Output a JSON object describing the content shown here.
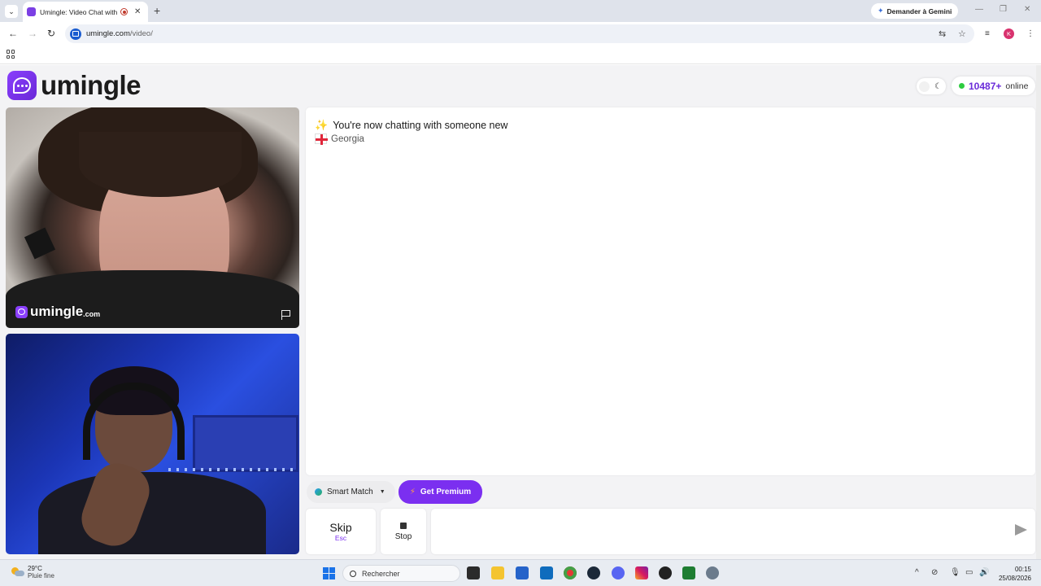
{
  "browser": {
    "tab_title": "Umingle: Video Chat with S",
    "tab_close": "✕",
    "new_tab": "+",
    "gemini_label": "Demander à Gemini",
    "url_host": "umingle.com",
    "url_path": "/video/",
    "profile_initial": "K"
  },
  "header": {
    "logo_text": "umingle",
    "online_count": "10487+",
    "online_label": "online"
  },
  "video": {
    "watermark_text": "umingle",
    "watermark_domain": ".com"
  },
  "chat": {
    "message": "You're now chatting with someone new",
    "country": "Georgia",
    "input_placeholder": ""
  },
  "controls": {
    "smart_match_label": "Smart Match",
    "premium_label": "Get Premium",
    "skip_label": "Skip",
    "skip_key": "Esc",
    "stop_label": "Stop"
  },
  "taskbar": {
    "temperature": "29°C",
    "weather": "Pluie fine",
    "search_placeholder": "Rechercher",
    "time": "00:15",
    "date": "25/08/2026"
  },
  "colors": {
    "brand": "#7b2ff0",
    "online_dot": "#2ecc40",
    "online_count": "#6a2bd9"
  }
}
